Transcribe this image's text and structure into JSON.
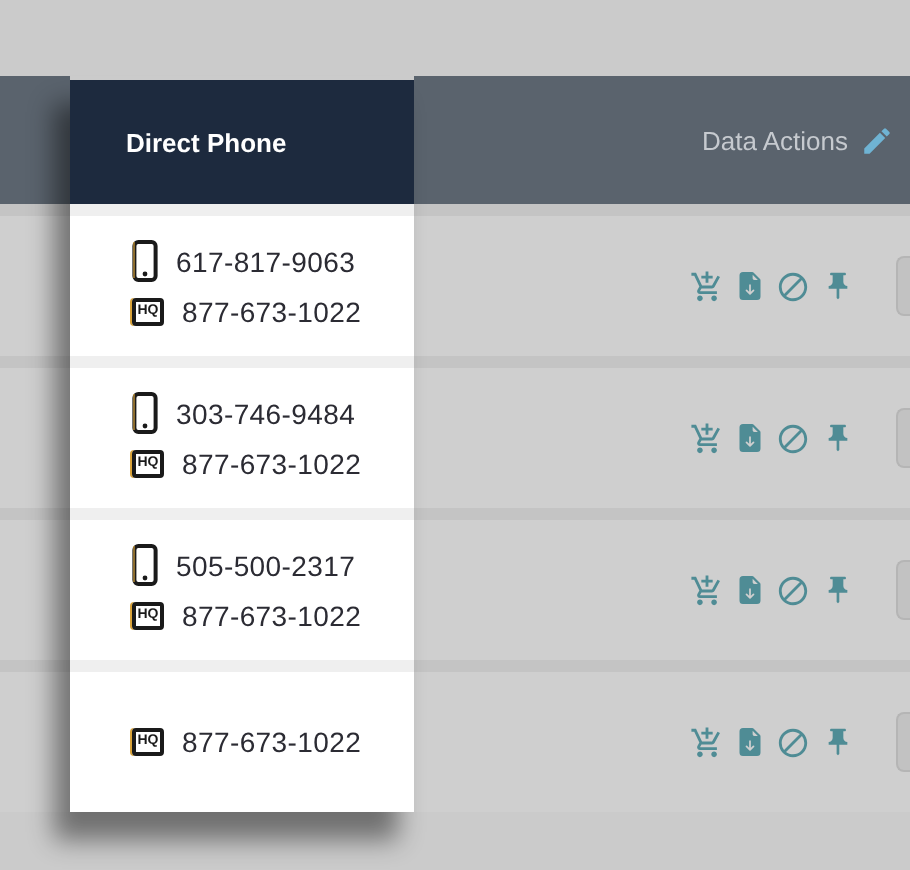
{
  "table": {
    "columns": [
      {
        "label": "Direct Phone",
        "highlighted": true
      },
      {
        "label": "Data Actions",
        "highlighted": false
      }
    ],
    "rows": [
      {
        "phones": [
          {
            "kind": "mobile",
            "number": "617-817-9063"
          },
          {
            "kind": "hq",
            "badge": "HQ",
            "number": "877-673-1022"
          }
        ]
      },
      {
        "phones": [
          {
            "kind": "mobile",
            "number": "303-746-9484"
          },
          {
            "kind": "hq",
            "badge": "HQ",
            "number": "877-673-1022"
          }
        ]
      },
      {
        "phones": [
          {
            "kind": "mobile",
            "number": "505-500-2317"
          },
          {
            "kind": "hq",
            "badge": "HQ",
            "number": "877-673-1022"
          }
        ]
      },
      {
        "phones": [
          {
            "kind": "hq",
            "badge": "HQ",
            "number": "877-673-1022"
          }
        ]
      }
    ]
  }
}
